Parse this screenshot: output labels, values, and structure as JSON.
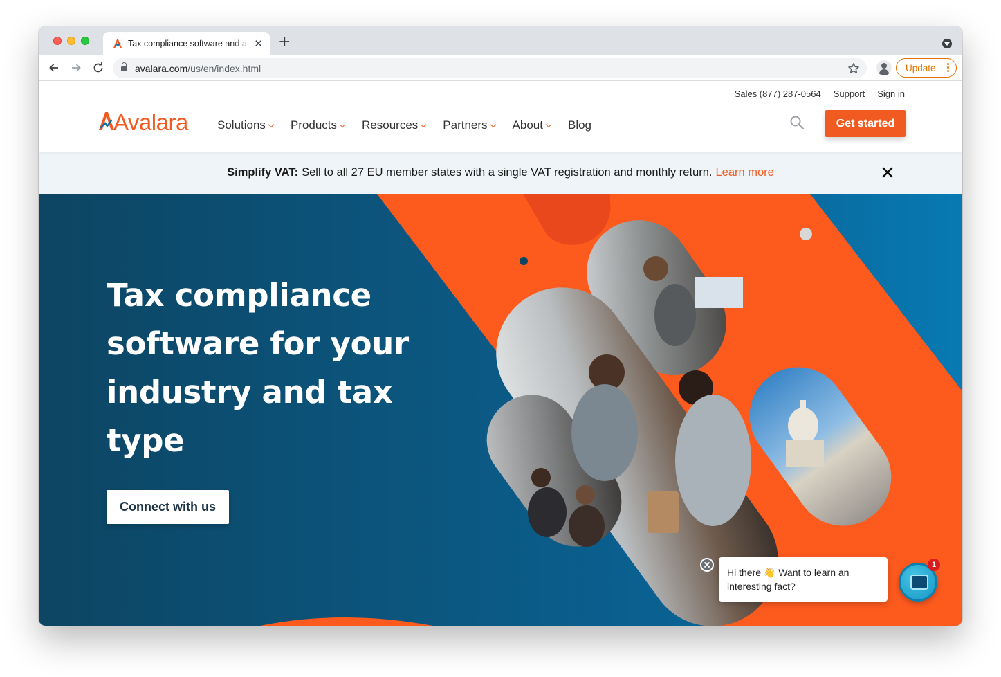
{
  "browser": {
    "tab": {
      "title": "Tax compliance software and a",
      "close": "✕"
    },
    "new_tab": "+",
    "url": {
      "host": "avalara.com",
      "path": "/us/en/index.html"
    },
    "update_label": "Update"
  },
  "site": {
    "logo_text": "Avalara",
    "utility": [
      "Sales (877) 287-0564",
      "Support",
      "Sign in"
    ],
    "nav": [
      "Solutions",
      "Products",
      "Resources",
      "Partners",
      "About",
      "Blog"
    ],
    "cta": "Get started"
  },
  "banner": {
    "bold": "Simplify VAT:",
    "text": "Sell to all 27 EU member states with a single VAT registration and monthly return.",
    "link": "Learn more"
  },
  "hero": {
    "title_lines": [
      "Tax compliance",
      "software for your",
      "industry and tax",
      "type"
    ],
    "button": "Connect with us"
  },
  "chat": {
    "line1": "Hi there 👋 Want to learn an",
    "line2": "interesting fact?",
    "badge": "1"
  },
  "colors": {
    "brand_orange": "#f15b22",
    "hero_blue": "#075f8a",
    "hero_dark": "#0d4563"
  }
}
